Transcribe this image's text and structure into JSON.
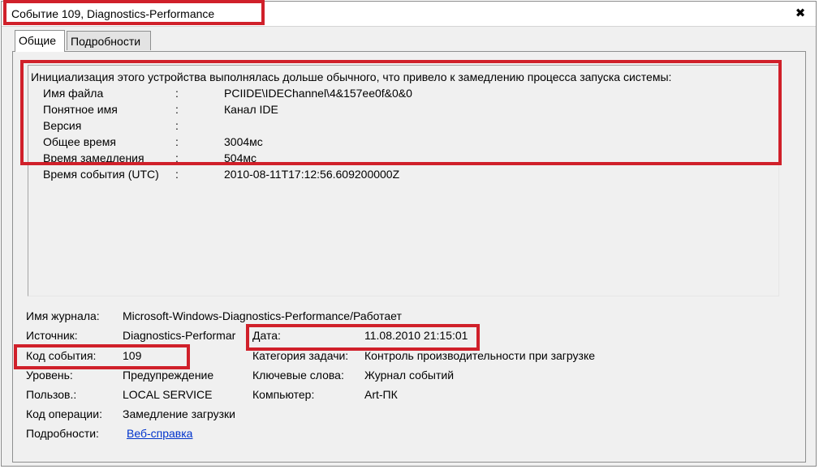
{
  "window": {
    "title": "Событие 109, Diagnostics-Performance",
    "close_glyph": "✖"
  },
  "tabs": [
    {
      "label": "Общие",
      "active": true
    },
    {
      "label": "Подробности",
      "active": false
    }
  ],
  "description": {
    "intro": "Инициализация этого устройства выполнялась дольше обычного, что привело к замедлению процесса запуска системы:",
    "separator": ":",
    "rows": [
      {
        "key": "Имя файла",
        "value": "PCIIDE\\IDEChannel\\4&157ee0f&0&0"
      },
      {
        "key": "Понятное имя",
        "value": "Канал IDE"
      },
      {
        "key": "Версия",
        "value": ""
      },
      {
        "key": "Общее время",
        "value": "3004мс"
      },
      {
        "key": "Время замедления",
        "value": "504мс"
      },
      {
        "key": "Время события (UTC)",
        "value": "2010-08-11T17:12:56.609200000Z"
      }
    ]
  },
  "details": {
    "log_name_label": "Имя журнала:",
    "log_name_value": "Microsoft-Windows-Diagnostics-Performance/Работает",
    "source_label": "Источник:",
    "source_value": "Diagnostics-Performar",
    "date_label": "Дата:",
    "date_value": "11.08.2010 21:15:01",
    "event_id_label": "Код события:",
    "event_id_value": "109",
    "task_category_label": "Категория задачи:",
    "task_category_value": "Контроль производительности при загрузке",
    "level_label": "Уровень:",
    "level_value": "Предупреждение",
    "keywords_label": "Ключевые слова:",
    "keywords_value": "Журнал событий",
    "user_label": "Пользов.:",
    "user_value": "LOCAL SERVICE",
    "computer_label": "Компьютер:",
    "computer_value": "Art-ПК",
    "opcode_label": "Код операции:",
    "opcode_value": "Замедление загрузки",
    "more_info_label": "Подробности:",
    "more_info_link": "Веб-справка"
  },
  "colors": {
    "highlight": "#d0202a",
    "link": "#0033cc",
    "background": "#f0f0f0"
  }
}
